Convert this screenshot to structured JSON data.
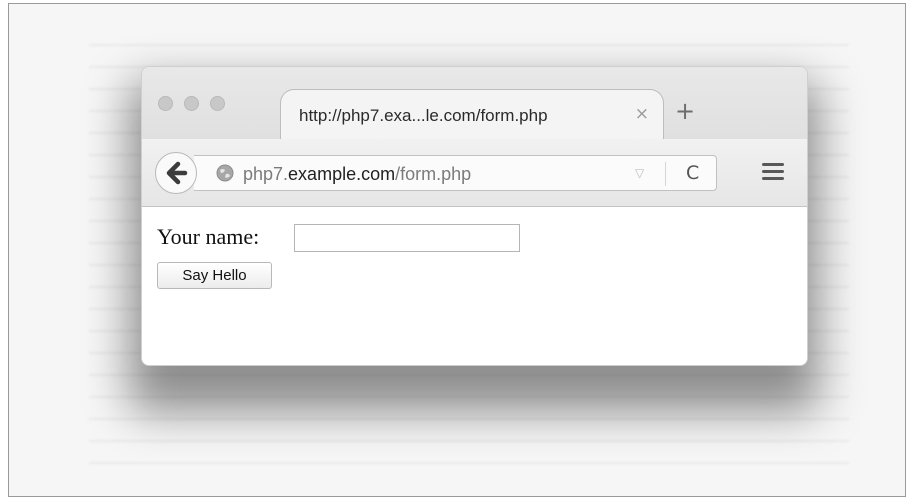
{
  "browser": {
    "tab_title": "http://php7.exa...le.com/form.php",
    "tab_close_glyph": "×",
    "new_tab_glyph": "+",
    "url_prefix": "php7.",
    "url_host": "example.com",
    "url_path": "/form.php",
    "url_dropdown_glyph": "▽",
    "reload_glyph": "C",
    "icons": {
      "back": "back-arrow-icon",
      "site": "globe-icon",
      "menu": "hamburger-menu-icon"
    }
  },
  "form": {
    "label": "Your name:",
    "name_value": "",
    "submit_label": "Say Hello"
  }
}
